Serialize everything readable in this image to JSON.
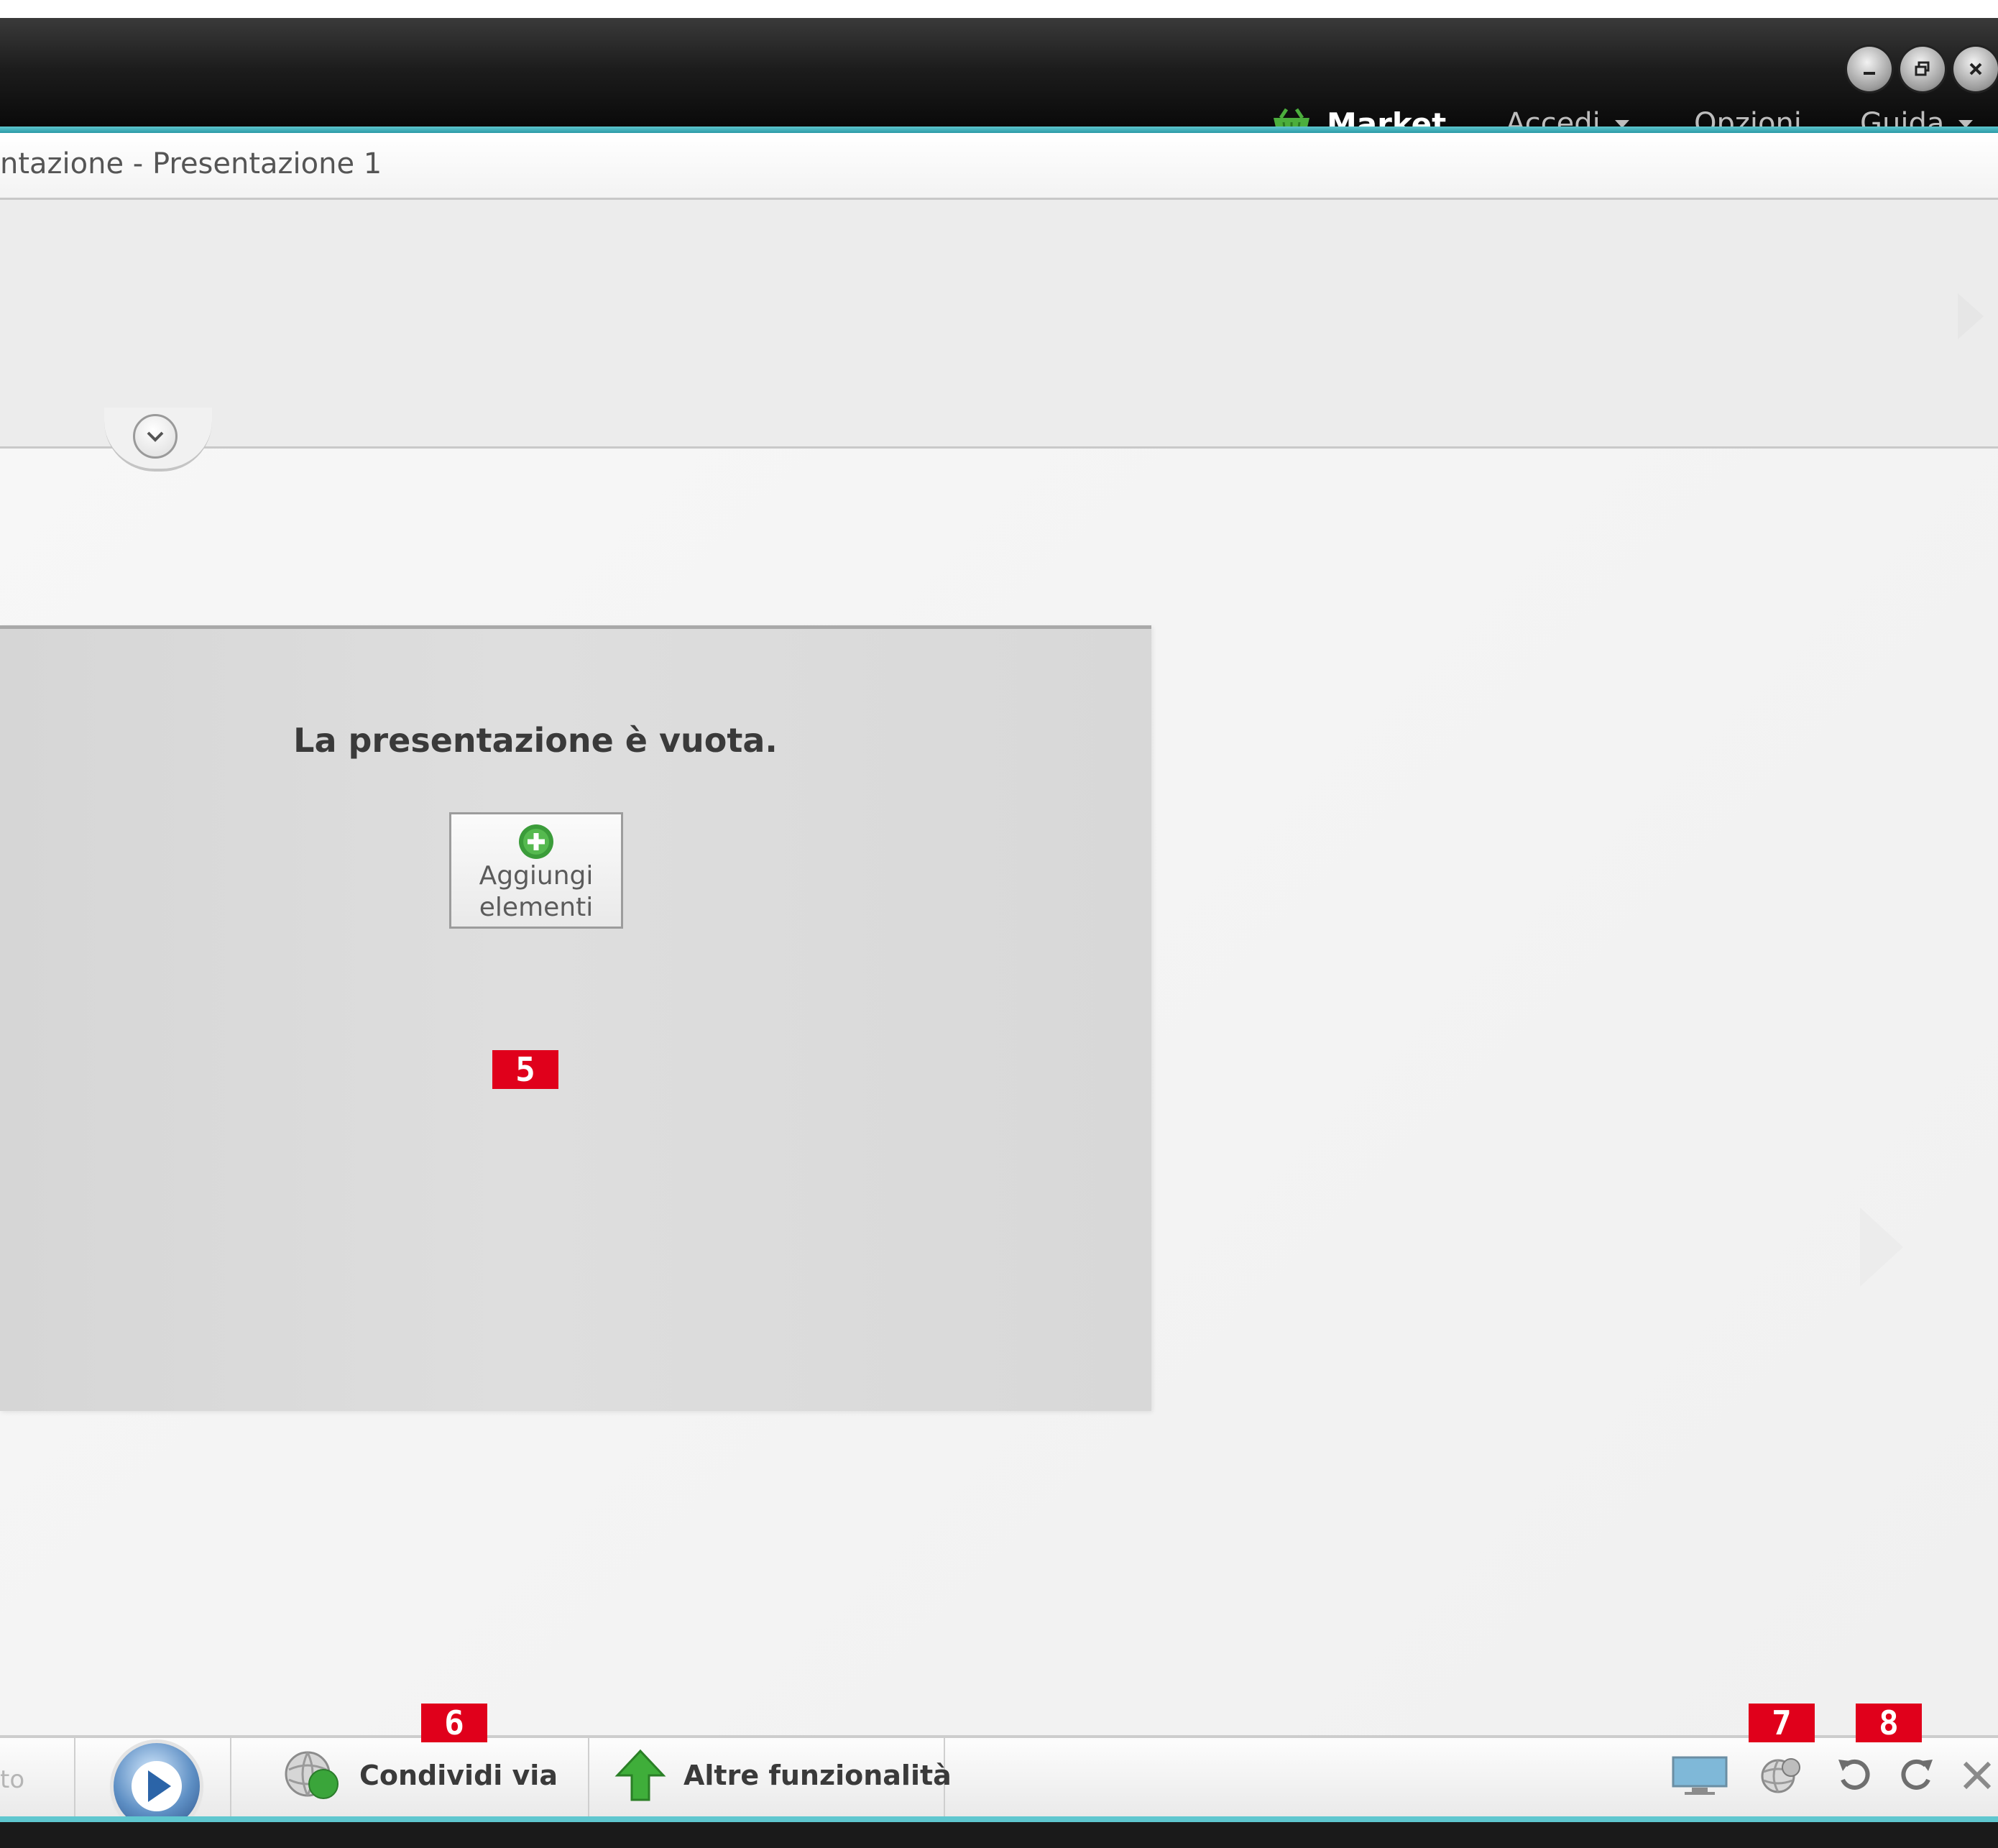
{
  "window": {
    "controls": [
      "minimize-icon",
      "restore-icon",
      "close-icon"
    ]
  },
  "menu": {
    "market": "Market",
    "accedi": "Accedi",
    "opzioni": "Opzioni",
    "guida": "Guida"
  },
  "document": {
    "title": "ntazione - Presentazione 1"
  },
  "slide": {
    "empty_message": "La presentazione è vuota.",
    "add_button_line1": "Aggiungi",
    "add_button_line2": "elementi"
  },
  "markers": {
    "m5": "5",
    "m6": "6",
    "m7": "7",
    "m8": "8"
  },
  "toolbar": {
    "partial_label": "to",
    "share_label": "Condividi via",
    "more_label": "Altre funzionalità",
    "tray_icons": [
      "monitor-icon",
      "settings-globe-icon",
      "undo-icon",
      "redo-icon",
      "close-icon"
    ]
  },
  "colors": {
    "accent_teal": "#3fb1bb",
    "marker_red": "#e0001b",
    "titlebar_dark": "#111111"
  }
}
